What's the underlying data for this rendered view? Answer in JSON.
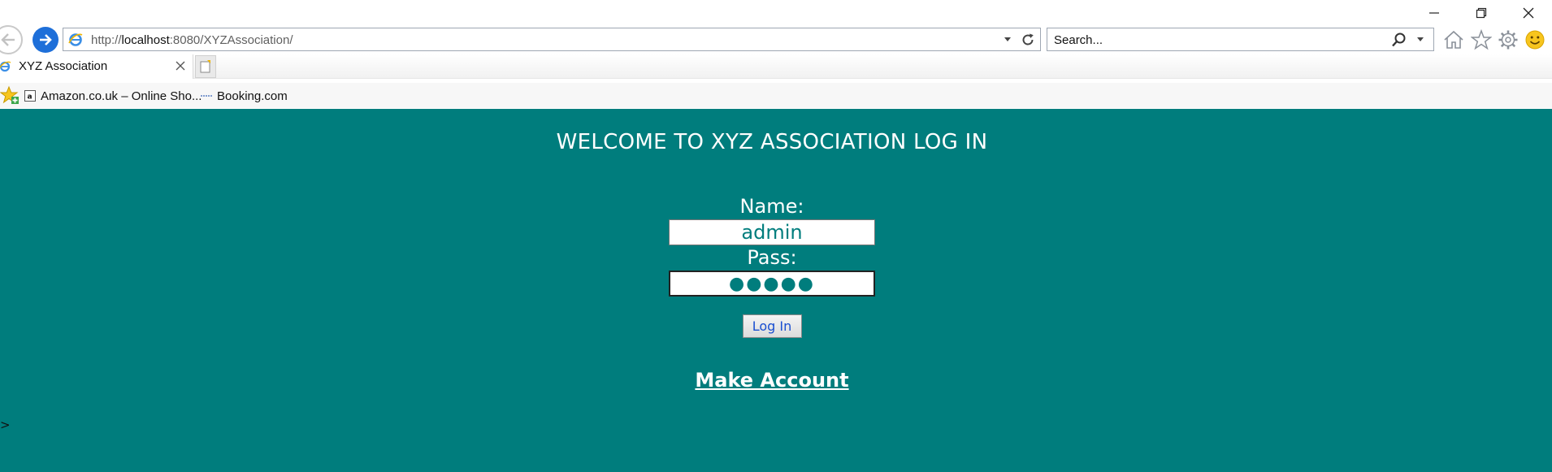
{
  "browser": {
    "address_url_prefix": "http://",
    "address_url_host": "localhost",
    "address_url_rest": ":8080/XYZAssociation/",
    "search_placeholder": "Search...",
    "tab_title": "XYZ Association",
    "favorites": [
      {
        "label": "Amazon.co.uk – Online Sho...",
        "icon": "amazon-icon"
      },
      {
        "label": "Booking.com",
        "icon": "booking-icon"
      }
    ],
    "accent_color": "#1e6fd9"
  },
  "page": {
    "background_color": "#007d7d",
    "heading": "WELCOME TO XYZ ASSOCIATION LOG IN",
    "name_label": "Name:",
    "name_value": "admin",
    "pass_label": "Pass:",
    "pass_value": "●●●●●",
    "login_button": "Log In",
    "make_account_link": "Make Account",
    "stray_text": ">"
  }
}
